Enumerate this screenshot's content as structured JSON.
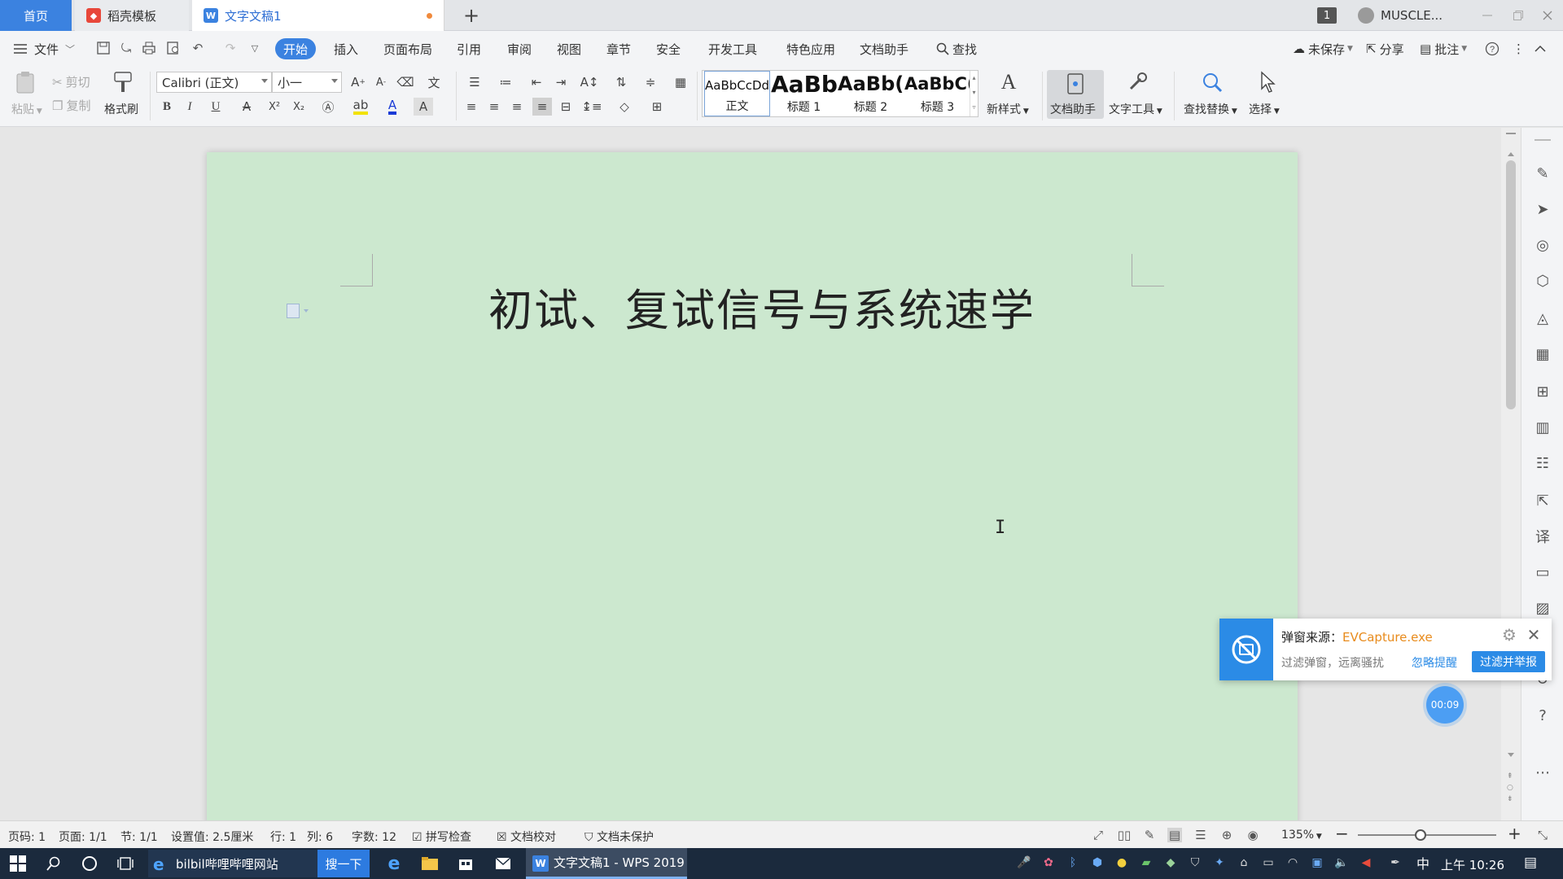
{
  "tabs": {
    "home": "首页",
    "template": "稻壳模板",
    "document": "文字文稿1",
    "add": "+"
  },
  "titlebar": {
    "window_count": "1",
    "user_name": "MUSCLE..."
  },
  "menu": {
    "file": "文件",
    "items": [
      "开始",
      "插入",
      "页面布局",
      "引用",
      "审阅",
      "视图",
      "章节",
      "安全",
      "开发工具",
      "特色应用",
      "文档助手"
    ],
    "search": "查找",
    "unsaved": "未保存",
    "share": "分享",
    "annotate": "批注"
  },
  "ribbon": {
    "paste": "粘贴",
    "cut": "剪切",
    "copy": "复制",
    "format_painter": "格式刷",
    "font_name": "Calibri (正文)",
    "font_size": "小一",
    "styles": [
      {
        "sample": "AaBbCcDd",
        "name": "正文"
      },
      {
        "sample": "AaBb",
        "name": "标题 1"
      },
      {
        "sample": "AaBb(",
        "name": "标题 2"
      },
      {
        "sample": "AaBbC(",
        "name": "标题 3"
      }
    ],
    "new_style": "新样式",
    "doc_assistant": "文档助手",
    "text_tools": "文字工具",
    "find_replace": "查找替换",
    "select": "选择",
    "bold": "B",
    "italic": "I",
    "underline": "U"
  },
  "document": {
    "title": "初试、复试信号与系统速学"
  },
  "popup": {
    "source_label": "弹窗来源：",
    "source_value": "EVCapture.exe",
    "description": "过滤弹窗，远离骚扰",
    "ignore": "忽略提醒",
    "filter": "过滤并举报",
    "timer": "00:09"
  },
  "status": {
    "page_num": "页码: 1",
    "pages": "页面: 1/1",
    "section": "节: 1/1",
    "setting": "设置值: 2.5厘米",
    "row": "行: 1",
    "col": "列: 6",
    "word_count": "字数: 12",
    "spell_check": "拼写检查",
    "doc_proof": "文档校对",
    "protect": "文档未保护",
    "zoom": "135%",
    "zoom_level": 0.45
  },
  "taskbar": {
    "search_text": "bilbil哔哩哔哩网站",
    "search_button": "搜一下",
    "wps_window": "文字文稿1 - WPS 2019",
    "ime": "中",
    "clock": "上午 10:26"
  },
  "colors": {
    "accent": "#3b82e0",
    "page_bg": "#cce8cf",
    "popup_blue": "#2b8be6",
    "popup_source": "#e88b1c"
  }
}
